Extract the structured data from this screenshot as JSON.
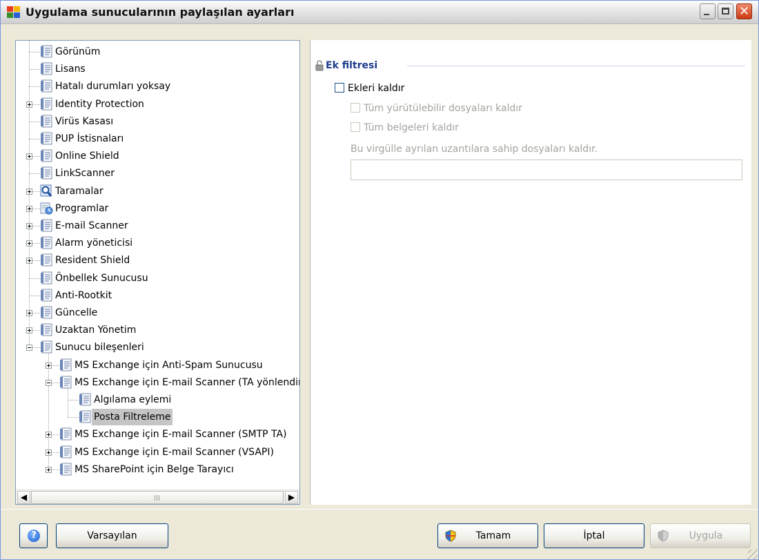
{
  "window": {
    "title": "Uygulama sunucularının paylaşılan ayarları"
  },
  "tree": {
    "items": [
      {
        "label": "Görünüm",
        "expandable": false,
        "icon": "document-list-icon"
      },
      {
        "label": "Lisans",
        "expandable": false,
        "icon": "document-list-icon"
      },
      {
        "label": "Hatalı durumları yoksay",
        "expandable": false,
        "icon": "document-list-icon"
      },
      {
        "label": "Identity Protection",
        "expandable": true,
        "icon": "document-list-icon"
      },
      {
        "label": "Virüs Kasası",
        "expandable": false,
        "icon": "document-list-icon"
      },
      {
        "label": "PUP İstisnaları",
        "expandable": false,
        "icon": "document-list-icon"
      },
      {
        "label": "Online Shield",
        "expandable": true,
        "icon": "document-list-icon"
      },
      {
        "label": "LinkScanner",
        "expandable": false,
        "icon": "document-list-icon"
      },
      {
        "label": "Taramalar",
        "expandable": true,
        "icon": "scan-magnifier-icon"
      },
      {
        "label": "Programlar",
        "expandable": true,
        "icon": "schedule-clock-icon"
      },
      {
        "label": "E-mail Scanner",
        "expandable": true,
        "icon": "document-list-icon"
      },
      {
        "label": "Alarm yöneticisi",
        "expandable": true,
        "icon": "document-list-icon"
      },
      {
        "label": "Resident Shield",
        "expandable": true,
        "icon": "document-list-icon"
      },
      {
        "label": "Önbellek Sunucusu",
        "expandable": false,
        "icon": "document-list-icon"
      },
      {
        "label": "Anti-Rootkit",
        "expandable": false,
        "icon": "document-list-icon"
      },
      {
        "label": "Güncelle",
        "expandable": true,
        "icon": "document-list-icon"
      },
      {
        "label": "Uzaktan Yönetim",
        "expandable": true,
        "icon": "document-list-icon"
      },
      {
        "label": "Sunucu bileşenleri",
        "expandable": true,
        "expanded": true,
        "icon": "document-list-icon"
      },
      {
        "label": "MS Exchange için Anti-Spam Sunucusu",
        "expandable": true,
        "icon": "document-list-icon"
      },
      {
        "label": "MS Exchange için E-mail Scanner (TA yönlendiri",
        "expandable": true,
        "expanded": true,
        "icon": "document-list-icon"
      },
      {
        "label": "Algılama eylemi",
        "expandable": false,
        "icon": "document-list-icon"
      },
      {
        "label": "Posta Filtreleme",
        "expandable": false,
        "selected": true,
        "icon": "document-list-icon"
      },
      {
        "label": "MS Exchange için E-mail Scanner (SMTP TA)",
        "expandable": true,
        "icon": "document-list-icon"
      },
      {
        "label": "MS Exchange için E-mail Scanner (VSAPI)",
        "expandable": true,
        "icon": "document-list-icon"
      },
      {
        "label": "MS SharePoint için Belge Tarayıcı",
        "expandable": true,
        "icon": "document-list-icon"
      }
    ],
    "scroll_thumb_glyph": "III"
  },
  "content": {
    "group_title": "Ek filtresi",
    "remove_attachments": {
      "label": "Ekleri kaldır",
      "checked": false,
      "enabled": true
    },
    "remove_executables": {
      "label": "Tüm yürütülebilir dosyaları kaldır",
      "checked": false,
      "enabled": false
    },
    "remove_documents": {
      "label": "Tüm belgeleri kaldır",
      "checked": false,
      "enabled": false
    },
    "extensions_label": "Bu virgülle ayrılan uzantılara sahip dosyaları kaldır.",
    "extensions_value": ""
  },
  "buttons": {
    "help_glyph": "?",
    "defaults": "Varsayılan",
    "ok": "Tamam",
    "cancel": "İptal",
    "apply": "Uygula"
  },
  "colors": {
    "group_title": "#1d3d8c",
    "selection": "#c5c5c5",
    "disabled_text": "#a3a39e"
  }
}
